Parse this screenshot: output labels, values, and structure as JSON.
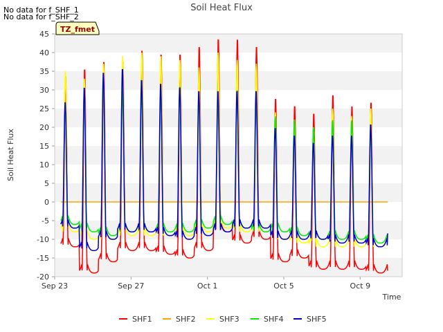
{
  "notes": [
    "No data for f_SHF_1",
    "No data for f_SHF_2"
  ],
  "chart_data": {
    "type": "line",
    "title": "Soil Heat Flux",
    "xlabel": "Time",
    "ylabel": "Soil Heat Flux",
    "badge": "TZ_fmet",
    "ylim": [
      -20,
      45
    ],
    "yticks": [
      -20,
      -15,
      -10,
      -5,
      0,
      5,
      10,
      15,
      20,
      25,
      30,
      35,
      40,
      45
    ],
    "xlim_days": [
      0,
      18.2
    ],
    "xticks": [
      {
        "label": "Sep 23",
        "day": 0
      },
      {
        "label": "Sep 27",
        "day": 4
      },
      {
        "label": "Oct 1",
        "day": 8
      },
      {
        "label": "Oct 5",
        "day": 12
      },
      {
        "label": "Oct 9",
        "day": 16
      }
    ],
    "grid": "horizontal bands",
    "legend": "bottom",
    "series_style": [
      {
        "name": "SHF1",
        "color": "#ff0000"
      },
      {
        "name": "SHF2",
        "color": "#ffa500"
      },
      {
        "name": "SHF3",
        "color": "#ffff00"
      },
      {
        "name": "SHF4",
        "color": "#00ee00"
      },
      {
        "name": "SHF5",
        "color": "#0000cc"
      }
    ],
    "daily_extremes": {
      "SHF1_max": [
        34,
        36,
        38,
        38,
        41,
        40,
        40,
        42,
        44,
        44,
        42,
        28,
        26,
        24,
        29,
        26,
        27
      ],
      "SHF1_min": [
        -12,
        -19,
        -16,
        -13,
        -13,
        -14,
        -15,
        -13,
        -8,
        -11,
        -10,
        -16,
        -15,
        -18,
        -18,
        -18,
        -19
      ],
      "SHF3_max": [
        35,
        33,
        37,
        39,
        40,
        39,
        38,
        36,
        40,
        38,
        37,
        24,
        22,
        20,
        25,
        23,
        25
      ],
      "SHF3_min": [
        -8,
        -10,
        -10,
        -9,
        -9,
        -9,
        -9,
        -8,
        -7,
        -8,
        -8,
        -10,
        -11,
        -12,
        -12,
        -12,
        -12
      ],
      "SHF4_max": [
        26,
        30,
        34,
        30,
        30,
        30,
        31,
        28,
        27,
        30,
        27,
        23,
        22,
        20,
        22,
        22,
        20
      ],
      "SHF4_min": [
        -6,
        -8,
        -9,
        -8,
        -8,
        -8,
        -8,
        -7,
        -6,
        -7,
        -8,
        -8,
        -9,
        -10,
        -10,
        -10,
        -11
      ],
      "SHF5_max": [
        27,
        31,
        35,
        36,
        33,
        32,
        31,
        30,
        30,
        30,
        30,
        20,
        18,
        16,
        18,
        18,
        21
      ],
      "SHF5_min": [
        -7,
        -13,
        -10,
        -8,
        -8,
        -9,
        -10,
        -9,
        -8,
        -7,
        -7,
        -10,
        -10,
        -10,
        -11,
        -11,
        -12
      ],
      "SHF2_value": 0
    }
  }
}
